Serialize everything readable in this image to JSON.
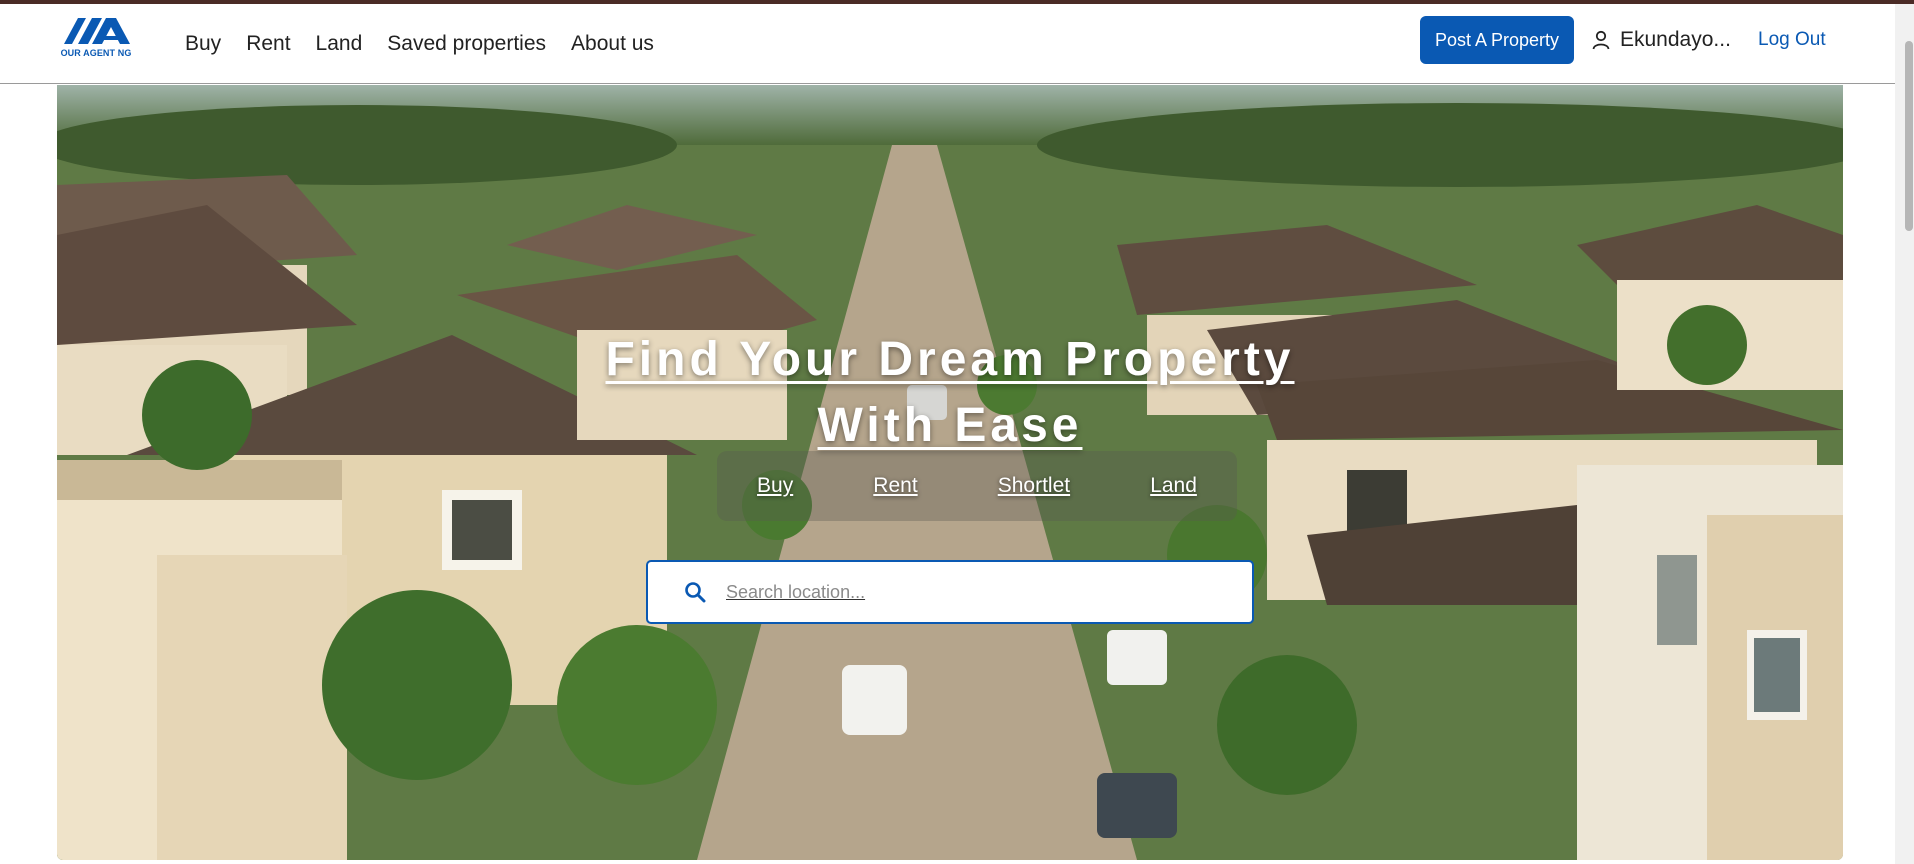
{
  "brand": {
    "logo_text": "OUR AGENT NG",
    "color": "#0a59b3"
  },
  "nav": {
    "items": [
      "Buy",
      "Rent",
      "Land",
      "Saved properties",
      "About us"
    ]
  },
  "header": {
    "post_button": "Post A Property",
    "user_name": "Ekundayo...",
    "logout": "Log Out",
    "user_icon": "user-icon"
  },
  "hero": {
    "title_line1": "Find Your Dream Property",
    "title_line2": "With Ease",
    "tabs": [
      "Buy",
      "Rent",
      "Shortlet",
      "Land"
    ],
    "search_placeholder": "Search location...",
    "search_icon": "search-icon"
  }
}
